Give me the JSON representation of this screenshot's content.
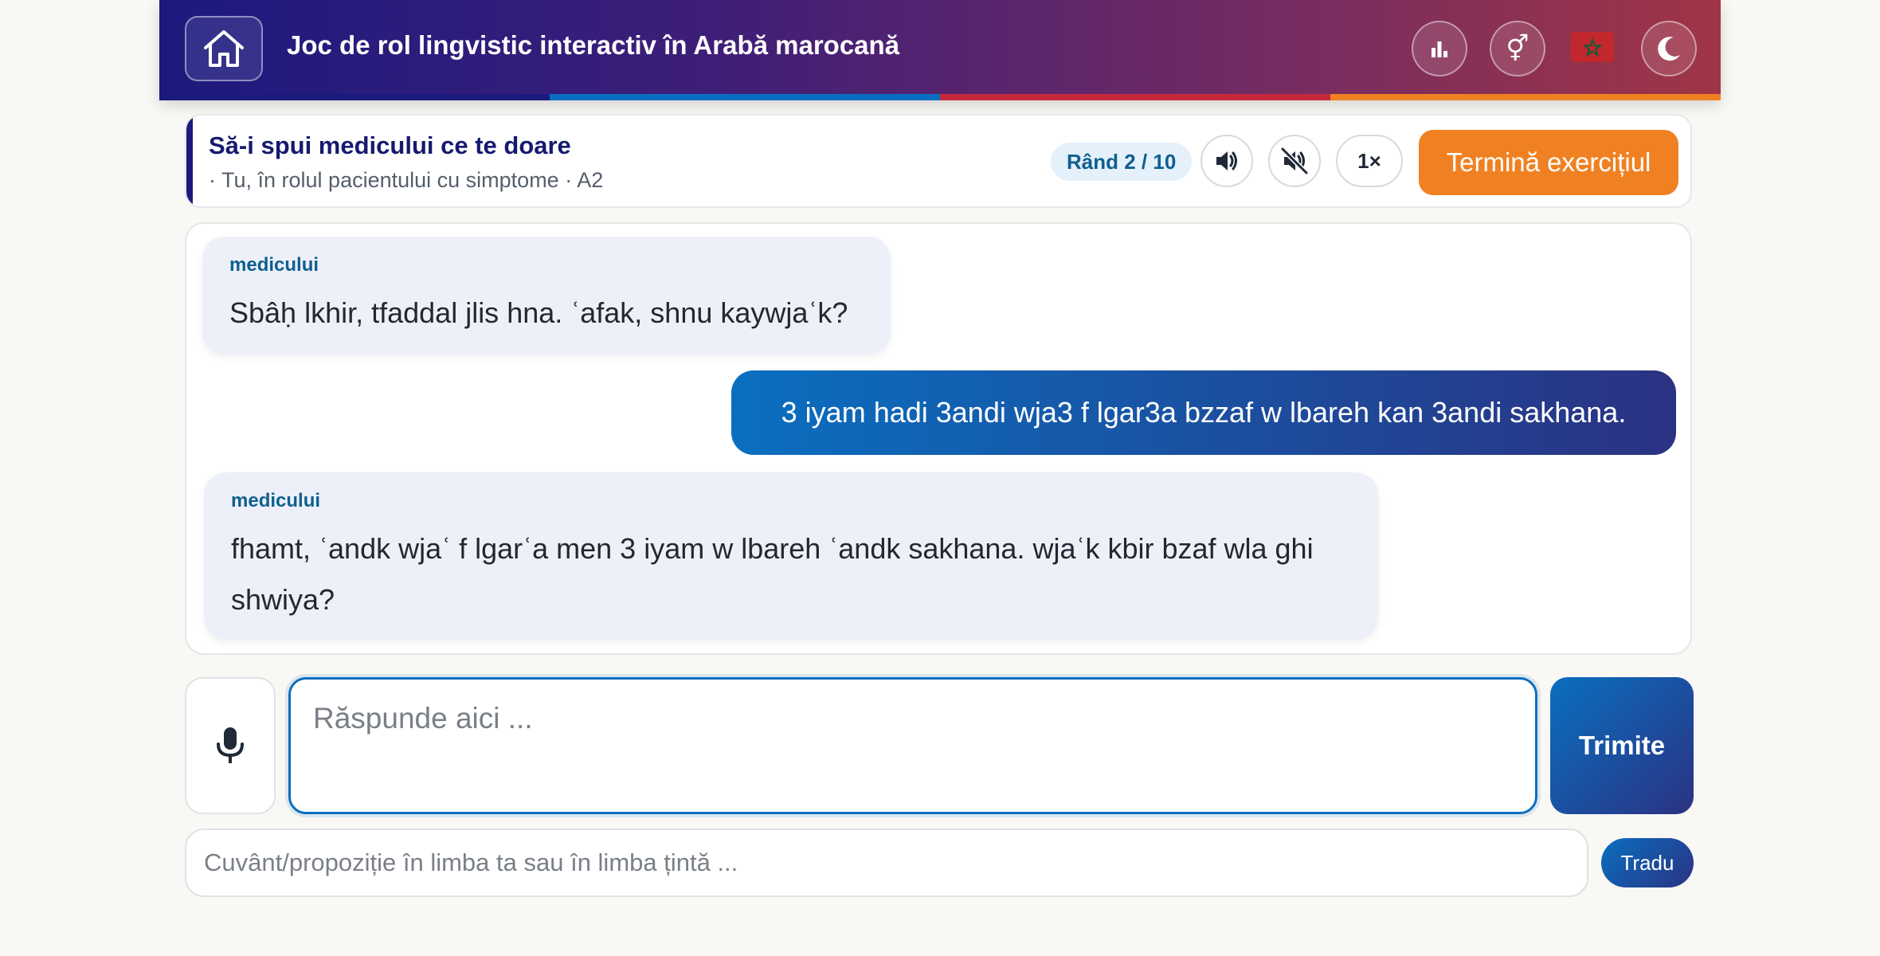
{
  "header": {
    "title": "Joc de rol lingvistic interactiv în Arabă marocană",
    "home_icon": "home-icon",
    "stats_icon": "bar-chart-icon",
    "gender_icon": "gender-icon",
    "flag_icon": "morocco-flag-icon",
    "theme_icon": "moon-icon",
    "stripe_colors": [
      "#1c1a7e",
      "#0a6fc0",
      "#c8283e",
      "#f08122"
    ]
  },
  "scenario": {
    "title": "Să-i spui medicului ce te doare",
    "subtitle": "· Tu, în rolul pacientului cu simptome · A2",
    "round": "Rând 2 / 10",
    "speaker_icon": "speaker-icon",
    "mute_icon": "speaker-muted-icon",
    "speed": "1×",
    "finish_label": "Termină exercițiul"
  },
  "chat": {
    "messages": [
      {
        "role": "bot",
        "speaker": "medicului",
        "text": "Sbâḥ lkhir, tfaddal jlis hna. ʿafak, shnu kaywjaʿk?"
      },
      {
        "role": "user",
        "text": "3 iyam hadi 3andi wja3 f lgar3a bzzaf w lbareh kan 3andi sakhana."
      },
      {
        "role": "bot",
        "speaker": "medicului",
        "text": "fhamt, ʿandk wjaʿ f lgarʿa men 3 iyam w lbareh ʿandk sakhana. wjaʿk kbir bzaf wla ghi shwiya?"
      }
    ]
  },
  "composer": {
    "mic_icon": "microphone-icon",
    "placeholder": "Răspunde aici ...",
    "send_label": "Trimite"
  },
  "translator": {
    "placeholder": "Cuvânt/propoziție în limba ta sau în limba țintă ...",
    "button_label": "Tradu"
  },
  "colors": {
    "accent": "#0a6fc0",
    "finish": "#f08122",
    "header_start": "#1c1a7e",
    "header_end": "#a03546"
  }
}
